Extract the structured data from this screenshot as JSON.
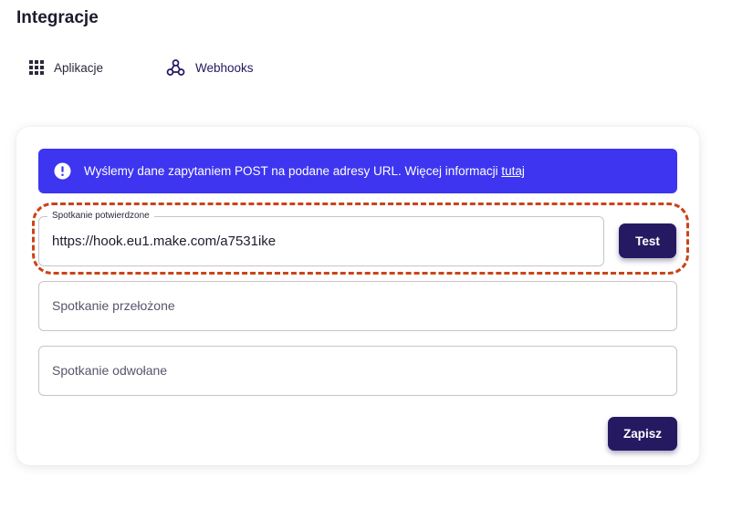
{
  "page": {
    "title": "Integracje"
  },
  "nav": {
    "items": [
      {
        "label": "Aplikacje",
        "icon": "grid-icon",
        "active": false
      },
      {
        "label": "Webhooks",
        "icon": "webhook-icon",
        "active": true
      }
    ]
  },
  "banner": {
    "icon": "info-icon",
    "text": "Wyślemy dane zapytaniem POST na podane adresy URL. Więcej informacji ",
    "link_text": "tutaj",
    "color": "#3d35ef"
  },
  "fields": {
    "confirmed": {
      "label": "Spotkanie potwierdzone",
      "value": "https://hook.eu1.make.com/a7531ike"
    },
    "rescheduled": {
      "placeholder": "Spotkanie przełożone",
      "value": ""
    },
    "cancelled": {
      "placeholder": "Spotkanie odwołane",
      "value": ""
    }
  },
  "buttons": {
    "test_label": "Test",
    "save_label": "Zapisz"
  },
  "colors": {
    "primary_button": "#251a62",
    "highlight": "#c9441a"
  }
}
